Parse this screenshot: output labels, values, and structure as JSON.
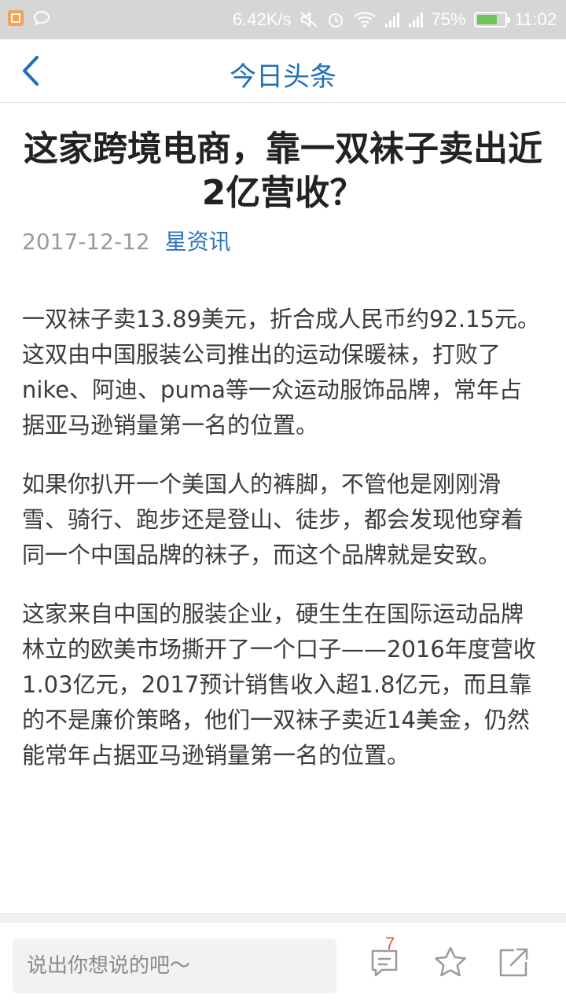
{
  "status_bar": {
    "net_speed": "6.42K/s",
    "battery_level": "75%",
    "battery_fraction": 0.75,
    "time": "11:02",
    "icons": [
      "app-notification-icon",
      "chat-bubble-icon",
      "mute-icon",
      "alarm-icon",
      "wifi-icon",
      "signal-icon",
      "signal-icon",
      "battery-icon"
    ]
  },
  "nav": {
    "title": "今日头条",
    "back_icon": "chevron-left-icon",
    "accent_color": "#1f6fb8"
  },
  "article": {
    "title": "这家跨境电商，靠一双袜子卖出近2亿营收？",
    "date": "2017-12-12",
    "source": "星资讯",
    "paragraphs": [
      "一双袜子卖13.89美元，折合成人民币约92.15元。这双由中国服装公司推出的运动保暖袜，打败了nike、阿迪、puma等一众运动服饰品牌，常年占据亚马逊销量第一名的位置。",
      "如果你扒开一个美国人的裤脚，不管他是刚刚滑雪、骑行、跑步还是登山、徒步，都会发现他穿着同一个中国品牌的袜子，而这个品牌就是安致。",
      "这家来自中国的服装企业，硬生生在国际运动品牌林立的欧美市场撕开了一个口子——2016年度营收1.03亿元，2017预计销售收入超1.8亿元，而且靠的不是廉价策略，他们一双袜子卖近14美金，仍然能常年占据亚马逊销量第一名的位置。"
    ]
  },
  "bottom_bar": {
    "comment_placeholder": "说出你想说的吧～",
    "comment_count": "7",
    "icons": [
      "comment-icon",
      "star-icon",
      "share-icon"
    ]
  }
}
